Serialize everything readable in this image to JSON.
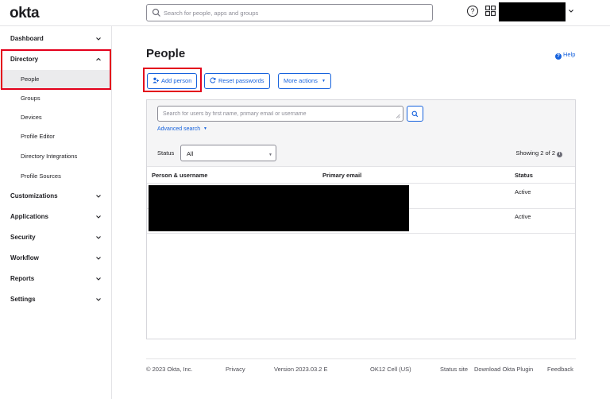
{
  "topbar": {
    "logo": "okta",
    "search_placeholder": "Search for people, apps and groups"
  },
  "sidebar": {
    "sections": [
      {
        "label": "Dashboard"
      },
      {
        "label": "Directory",
        "expanded": true,
        "items": [
          {
            "label": "People",
            "active": true
          },
          {
            "label": "Groups"
          },
          {
            "label": "Devices"
          },
          {
            "label": "Profile Editor"
          },
          {
            "label": "Directory Integrations"
          },
          {
            "label": "Profile Sources"
          }
        ]
      },
      {
        "label": "Customizations"
      },
      {
        "label": "Applications"
      },
      {
        "label": "Security"
      },
      {
        "label": "Workflow"
      },
      {
        "label": "Reports"
      },
      {
        "label": "Settings"
      }
    ]
  },
  "main": {
    "title": "People",
    "help": "Help",
    "buttons": {
      "add_person": "Add person",
      "reset_passwords": "Reset passwords",
      "more_actions": "More actions"
    },
    "search_placeholder": "Search for users by first name, primary email or username",
    "advanced_search": "Advanced search",
    "status_label": "Status",
    "status_value": "All",
    "showing": "Showing 2 of 2",
    "columns": [
      "Person & username",
      "Primary email",
      "Status"
    ],
    "rows": [
      {
        "status": "Active"
      },
      {
        "status": "Active"
      }
    ]
  },
  "footer": {
    "copyright": "© 2023 Okta, Inc.",
    "privacy": "Privacy",
    "version": "Version 2023.03.2 E",
    "cell": "OK12 Cell (US)",
    "status_site": "Status site",
    "download_plugin": "Download Okta Plugin",
    "feedback": "Feedback"
  },
  "colors": {
    "accent": "#1662dd",
    "highlight": "#e3001b",
    "active_bg": "#ebebed"
  }
}
